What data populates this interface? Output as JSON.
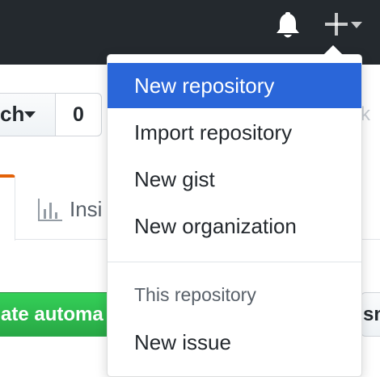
{
  "header": {
    "bell_icon": "bell-icon",
    "create_icon": "plus-icon"
  },
  "repo_toolbar": {
    "watch_label": "ch",
    "watch_count": "0",
    "right_fragment": "k"
  },
  "tabs": {
    "insights_label": "Insi"
  },
  "actions": {
    "green_button_label": "ate automa",
    "right_button_label": "sm"
  },
  "create_menu": {
    "items": [
      {
        "label": "New repository",
        "active": true
      },
      {
        "label": "Import repository"
      },
      {
        "label": "New gist"
      },
      {
        "label": "New organization"
      }
    ],
    "section_header": "This repository",
    "section_items": [
      {
        "label": "New issue"
      }
    ]
  },
  "colors": {
    "topbar": "#24292e",
    "active_item": "#2a66d9",
    "green_button": "#28a745"
  }
}
